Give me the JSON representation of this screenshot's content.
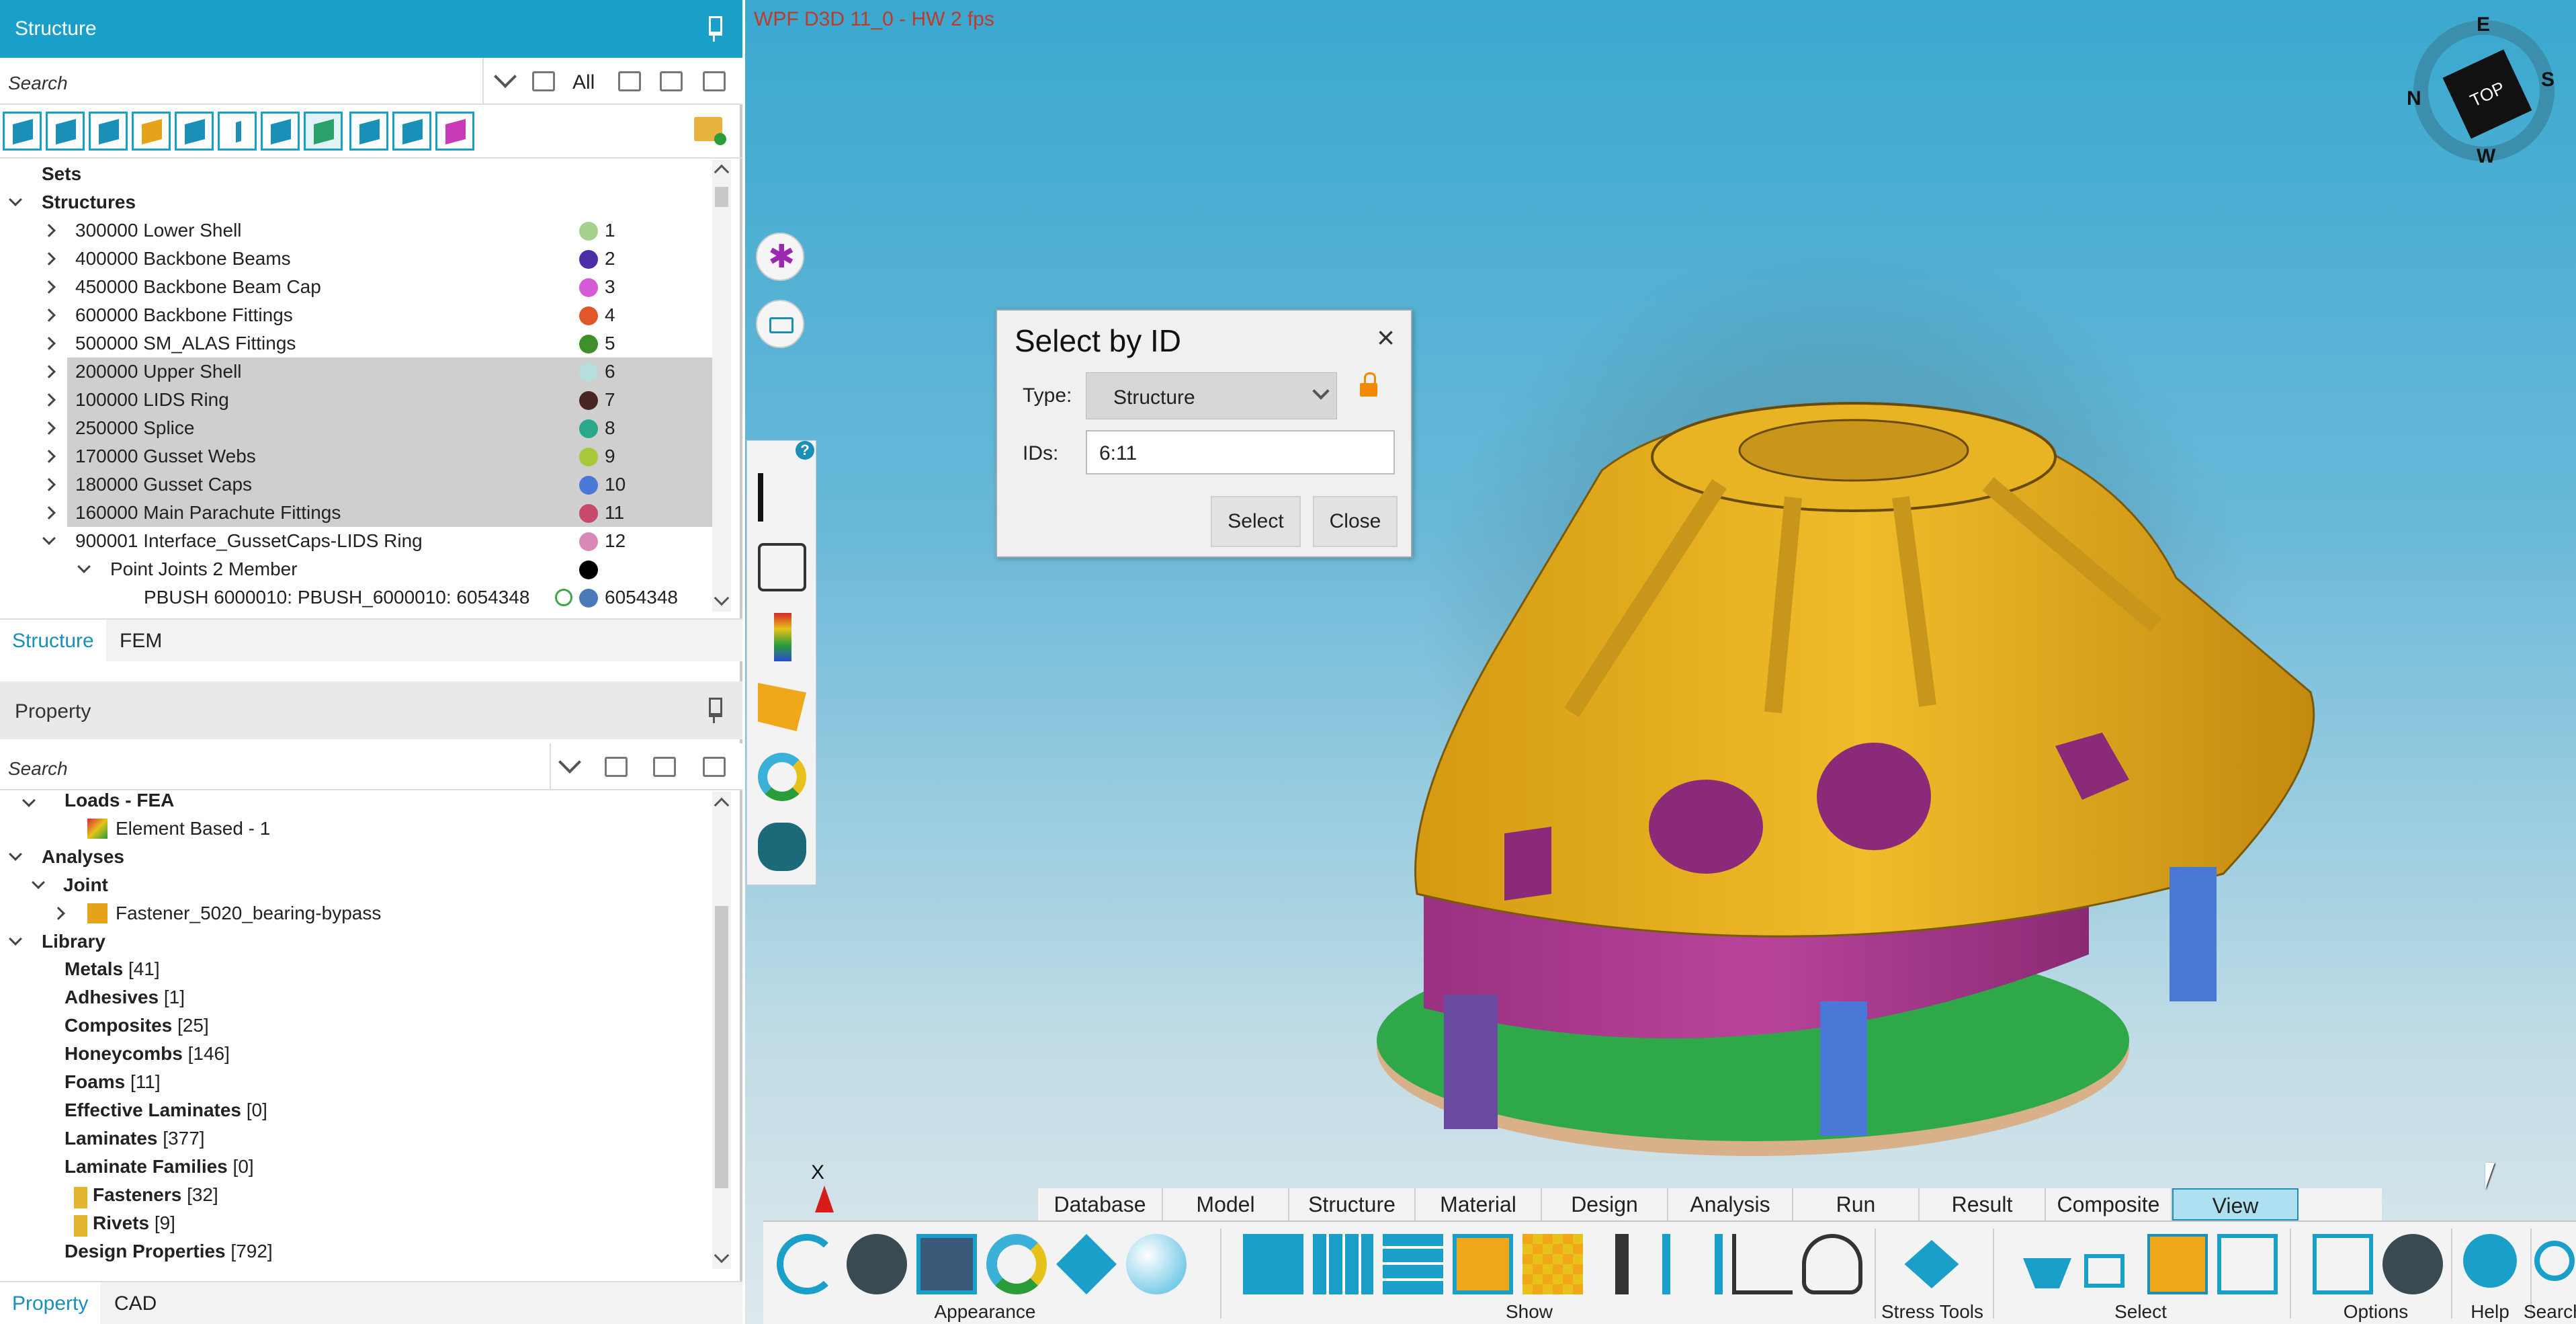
{
  "structure_panel": {
    "title": "Structure",
    "search_placeholder": "Search",
    "filter_label": "All",
    "tree": [
      {
        "label": "Sets",
        "level": 0
      },
      {
        "label": "Structures",
        "level": 0
      },
      {
        "label": "300000 Lower Shell",
        "num": "1",
        "color": "#a6d18a"
      },
      {
        "label": "400000 Backbone Beams",
        "num": "2",
        "color": "#4a2fa8"
      },
      {
        "label": "450000 Backbone Beam Cap",
        "num": "3",
        "color": "#d65ad6"
      },
      {
        "label": "600000 Backbone Fittings",
        "num": "4",
        "color": "#e0582a"
      },
      {
        "label": "500000 SM_ALAS Fittings",
        "num": "5",
        "color": "#3f8f2a"
      },
      {
        "label": "200000 Upper Shell",
        "num": "6",
        "color": "#b5dede"
      },
      {
        "label": "100000 LIDS Ring",
        "num": "7",
        "color": "#4a2323"
      },
      {
        "label": "250000 Splice",
        "num": "8",
        "color": "#2aa88c"
      },
      {
        "label": "170000 Gusset Webs",
        "num": "9",
        "color": "#a6c83a"
      },
      {
        "label": "180000 Gusset Caps",
        "num": "10",
        "color": "#4a78d6"
      },
      {
        "label": "160000 Main Parachute Fittings",
        "num": "11",
        "color": "#c84a6a"
      },
      {
        "label": "900001 Interface_GussetCaps-LIDS Ring",
        "num": "12",
        "color": "#d98ab8"
      },
      {
        "label": "Point Joints 2 Member",
        "num": "",
        "color": "#000000"
      },
      {
        "label": "PBUSH 6000010: PBUSH_6000010: 6054348",
        "num": "6054348",
        "color": "#4a7ab8"
      }
    ],
    "tabs": [
      "Structure",
      "FEM"
    ]
  },
  "property_panel": {
    "title": "Property",
    "search_placeholder": "Search",
    "tree": {
      "loads": "Loads - FEA",
      "element_based": "Element Based - 1",
      "analyses": "Analyses",
      "joint": "Joint",
      "fastener": "Fastener_5020_bearing-bypass",
      "library": "Library"
    },
    "library_items": [
      {
        "name": "Metals",
        "count": "[41]"
      },
      {
        "name": "Adhesives",
        "count": "[1]"
      },
      {
        "name": "Composites",
        "count": "[25]"
      },
      {
        "name": "Honeycombs",
        "count": "[146]"
      },
      {
        "name": "Foams",
        "count": "[11]"
      },
      {
        "name": "Effective Laminates",
        "count": "[0]"
      },
      {
        "name": "Laminates",
        "count": "[377]"
      },
      {
        "name": "Laminate Families",
        "count": "[0]"
      },
      {
        "name": "Fasteners",
        "count": "[32]"
      },
      {
        "name": "Rivets",
        "count": "[9]"
      },
      {
        "name": "Design Properties",
        "count": "[792]"
      }
    ],
    "tabs": [
      "Property",
      "CAD"
    ]
  },
  "viewport": {
    "overlay_title": "WPF D3D 11_0 - HW  2 fps",
    "compass": {
      "n": "N",
      "e": "E",
      "s": "S",
      "w": "W",
      "cube": "TOP"
    },
    "axis_label": "X",
    "help_badge": "?"
  },
  "dialog": {
    "title": "Select by ID",
    "close_glyph": "×",
    "type_label": "Type:",
    "type_value": "Structure",
    "ids_label": "IDs:",
    "ids_value": "6:11",
    "select_button": "Select",
    "close_button": "Close"
  },
  "menubar": [
    "Database",
    "Model",
    "Structure",
    "Material",
    "Design",
    "Analysis",
    "Run",
    "Result",
    "Composite",
    "View"
  ],
  "menubar_active": "View",
  "ribbon_groups": {
    "appearance": "Appearance",
    "show": "Show",
    "stress_tools": "Stress Tools",
    "select": "Select",
    "options": "Options",
    "help": "Help",
    "search": "Search"
  },
  "colors": {
    "accent": "#1aa0c8",
    "model_yellow": "#e0ac1a",
    "model_magenta": "#a8388c",
    "row_highlight": "#cfcfcf"
  }
}
